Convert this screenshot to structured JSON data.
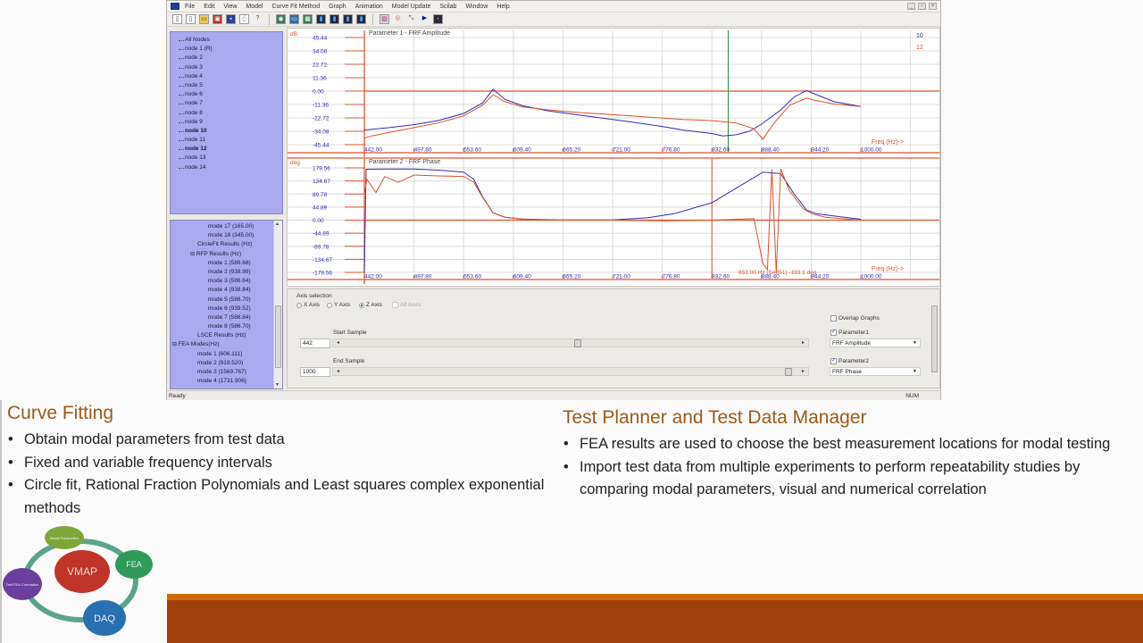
{
  "app": {
    "menu": [
      "File",
      "Edit",
      "View",
      "Model",
      "Curve Fit Method",
      "Graph",
      "Animation",
      "Model Update",
      "Scilab",
      "Window",
      "Help"
    ],
    "window_controls": [
      "minimize",
      "restore",
      "close"
    ],
    "toolbar_icons": [
      "new-file-icon",
      "copy-icon",
      "open-folder-icon",
      "model-icon",
      "save-icon",
      "print-icon",
      "help-icon",
      "view-icon",
      "window-icon",
      "grid-icon",
      "chart-icon",
      "chart-icon",
      "chart-icon",
      "chart-icon",
      "image-icon",
      "target-icon",
      "fit-icon",
      "play-icon",
      "record-icon"
    ],
    "status": {
      "left": "Ready",
      "right": "NUM"
    }
  },
  "node_tree": {
    "items": [
      {
        "label": "All Nodes",
        "bold": false
      },
      {
        "label": "node 1 (R)",
        "bold": false
      },
      {
        "label": "node 2",
        "bold": false
      },
      {
        "label": "node 3",
        "bold": false
      },
      {
        "label": "node 4",
        "bold": false
      },
      {
        "label": "node 5",
        "bold": false
      },
      {
        "label": "node 6",
        "bold": false
      },
      {
        "label": "node 7",
        "bold": false
      },
      {
        "label": "node 8",
        "bold": false
      },
      {
        "label": "node 9",
        "bold": false
      },
      {
        "label": "node 10",
        "bold": true
      },
      {
        "label": "node 11",
        "bold": false
      },
      {
        "label": "node 12",
        "bold": true
      },
      {
        "label": "node 13",
        "bold": false
      },
      {
        "label": "node 14",
        "bold": false
      }
    ]
  },
  "results_tree": {
    "items": [
      {
        "label": "mode 17 (165.00)",
        "level": 3
      },
      {
        "label": "mode 18 (345.00)",
        "level": 3
      },
      {
        "label": "CircleFit Results (Hz)",
        "level": 2
      },
      {
        "label": "RFP Results (Hz)",
        "level": 2,
        "expander": "−"
      },
      {
        "label": "mode 1 (586.68)",
        "level": 3
      },
      {
        "label": "mode 2 (938.99)",
        "level": 3
      },
      {
        "label": "mode 3 (586.64)",
        "level": 3
      },
      {
        "label": "mode 4 (938.84)",
        "level": 3
      },
      {
        "label": "mode 5 (586.70)",
        "level": 3
      },
      {
        "label": "mode 6 (939.52)",
        "level": 3
      },
      {
        "label": "mode 7 (586.84)",
        "level": 3
      },
      {
        "label": "mode 8 (586.70)",
        "level": 3
      },
      {
        "label": "LSCE Results (Hz)",
        "level": 2
      },
      {
        "label": "FEA Modes(Hz)",
        "level": 1,
        "expander": "−"
      },
      {
        "label": "mode 1 (606.111)",
        "level": 2
      },
      {
        "label": "mode 2 (919.520)",
        "level": 2
      },
      {
        "label": "mode 3 (1569.767)",
        "level": 2
      },
      {
        "label": "mode 4 (1731.906)",
        "level": 2
      }
    ]
  },
  "chart_data": [
    {
      "type": "line",
      "title": "Parameter 1 - FRF Amplitude",
      "ylabel": "dB",
      "xlabel": "Freq.(Hz)->",
      "x_ticks": [
        "442.00",
        "497.80",
        "553.60",
        "609.40",
        "665.20",
        "721.00",
        "776.80",
        "832.60",
        "888.40",
        "944.20",
        "1000.00"
      ],
      "y_ticks": [
        "45.44",
        "34.08",
        "22.72",
        "11.36",
        "0.00",
        "-11.36",
        "-22.72",
        "-34.08",
        "-45.44"
      ],
      "xlim": [
        442,
        1000
      ],
      "ylim": [
        -45.44,
        45.44
      ],
      "cursor_x": 851,
      "legend": [
        {
          "name": "10",
          "color": "#2f2fb0"
        },
        {
          "name": "12",
          "color": "#e0502a"
        }
      ],
      "series": [
        {
          "name": "10",
          "color": "#2f2fb0",
          "x": [
            442,
            470,
            497.8,
            525,
            553.6,
            575,
            586.7,
            600,
            620,
            650,
            680,
            721,
            750,
            776.8,
            800,
            832.6,
            845,
            860,
            875,
            888.4,
            910,
            925,
            939,
            950,
            970,
            1000
          ],
          "y": [
            -33,
            -31,
            -28.5,
            -25,
            -19,
            -10,
            1.5,
            -7,
            -12.5,
            -17,
            -20,
            -24,
            -27,
            -30,
            -33,
            -36,
            -38,
            -37,
            -34,
            -28,
            -16,
            -5,
            0.5,
            -3,
            -9,
            -13
          ]
        },
        {
          "name": "12",
          "color": "#e0502a",
          "x": [
            442,
            450,
            470,
            497.8,
            525,
            553.6,
            575,
            586.7,
            600,
            620,
            650,
            680,
            721,
            760,
            800,
            832.6,
            860,
            880,
            890,
            895,
            905,
            920,
            939,
            950,
            970,
            1000
          ],
          "y": [
            -40,
            -38,
            -35,
            -31,
            -27,
            -21,
            -12,
            -3,
            -9,
            -13.5,
            -16,
            -18,
            -20,
            -22,
            -24,
            -25,
            -27,
            -32,
            -41,
            -35,
            -25,
            -12,
            -6,
            -8,
            -11,
            -13
          ]
        }
      ]
    },
    {
      "type": "line",
      "title": "Parameter 2 - FRF Phase",
      "ylabel": "deg",
      "xlabel": "Freq.(Hz)->",
      "x_ticks": [
        "442.00",
        "497.80",
        "553.60",
        "609.40",
        "665.20",
        "721.00",
        "776.80",
        "832.60",
        "888.40",
        "944.20",
        "1000.00"
      ],
      "y_ticks": [
        "179.56",
        "134.67",
        "89.78",
        "44.89",
        "0.00",
        "-44.89",
        "-89.78",
        "-134.67",
        "-179.56"
      ],
      "xlim": [
        442,
        1000
      ],
      "ylim": [
        -179.56,
        179.56
      ],
      "cursor_x": 832.6,
      "annotation": "851.00 Hz (S#851) -193.1 deg",
      "series": [
        {
          "name": "10",
          "color": "#2f2fb0",
          "x": [
            442,
            444,
            470,
            497.8,
            525,
            553.6,
            565,
            575,
            586.7,
            600,
            620,
            660,
            721,
            760,
            790,
            832.6,
            860,
            890,
            910,
            925,
            939,
            950,
            970,
            1000
          ],
          "y": [
            -179,
            175,
            176,
            176,
            172,
            165,
            140,
            80,
            25,
            10,
            4,
            1,
            1,
            8,
            22,
            60,
            110,
            165,
            160,
            90,
            35,
            22,
            14,
            3
          ]
        },
        {
          "name": "12",
          "color": "#e0502a",
          "x": [
            442,
            445,
            455,
            465,
            480,
            497.8,
            525,
            553.6,
            565,
            575,
            586.7,
            600,
            620,
            660,
            721,
            780,
            832.6,
            880,
            890,
            895,
            900,
            905,
            910,
            920,
            935,
            945,
            960,
            1000
          ],
          "y": [
            90,
            140,
            95,
            150,
            130,
            155,
            152,
            150,
            130,
            78,
            25,
            10,
            3,
            0,
            0,
            -2,
            0,
            5,
            -150,
            -170,
            175,
            -180,
            176,
            100,
            40,
            22,
            10,
            0
          ]
        }
      ]
    }
  ],
  "axis_panel": {
    "group_label": "Axis selection",
    "radios": [
      {
        "label": "X Axis",
        "checked": false
      },
      {
        "label": "Y Axis",
        "checked": false
      },
      {
        "label": "Z Axis",
        "checked": true
      }
    ],
    "all_axes": {
      "label": "All Axes",
      "checked": false
    },
    "start_sample": {
      "label": "Start Sample",
      "value": "442",
      "position": 0.52
    },
    "end_sample": {
      "label": "End Sample",
      "value": "1000",
      "position": 1.0
    },
    "overlap_graphs": {
      "label": "Overlap Graphs",
      "checked": false
    },
    "parameter1": {
      "label": "Parameter1",
      "checked": true,
      "value": "FRF Amplitude"
    },
    "parameter2": {
      "label": "Parameter2",
      "checked": true,
      "value": "FRF Phase"
    }
  },
  "slide": {
    "left": {
      "title": "Curve Fitting",
      "bullets": [
        "Obtain modal parameters from test data",
        "Fixed and variable frequency intervals",
        "Circle fit, Rational Fraction Polynomials and Least squares complex exponential methods"
      ]
    },
    "right": {
      "title": "Test Planner and Test Data Manager",
      "bullets": [
        "FEA results are used to choose the best measurement locations for modal testing",
        "Import test data from multiple experiments to perform repeatability studies by comparing modal parameters, visual and numerical correlation"
      ]
    },
    "logo": {
      "center": "VMAP",
      "nodes": [
        "Modal Parameters",
        "FEA",
        "DAQ",
        "Test FEA Correlation"
      ],
      "colors": {
        "center": "#c0342a",
        "top": "#7fa637",
        "right": "#2f9a5a",
        "bottom": "#2a6fb0",
        "left": "#6a3f9e",
        "ring": "#5a9ea0"
      }
    },
    "colors": {
      "title": "#9b5a1a",
      "footer": "#a2400b",
      "footer_accent": "#d36a06"
    }
  }
}
